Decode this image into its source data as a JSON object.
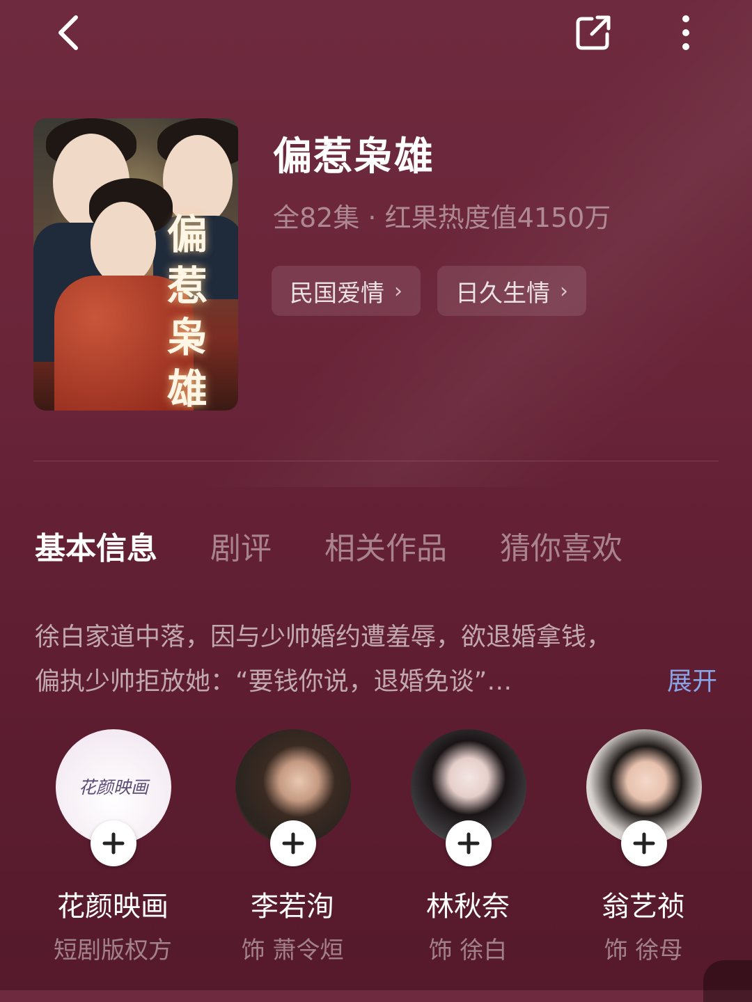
{
  "header": {
    "back_icon": "chevron-left-icon",
    "share_icon": "share-icon",
    "more_icon": "more-vertical-icon"
  },
  "drama": {
    "poster_title": "偏惹枭雄",
    "title": "偏惹枭雄",
    "meta": "全82集 · 红果热度值4150万",
    "tags": [
      {
        "label": "民国爱情",
        "icon": "chevron-right-icon"
      },
      {
        "label": "日久生情",
        "icon": "chevron-right-icon"
      }
    ]
  },
  "tabs": [
    {
      "label": "基本信息",
      "active": true
    },
    {
      "label": "剧评",
      "active": false
    },
    {
      "label": "相关作品",
      "active": false
    },
    {
      "label": "猜你喜欢",
      "active": false
    }
  ],
  "synopsis": {
    "line1": "徐白家道中落，因与少帅婚约遭羞辱，欲退婚拿钱，",
    "line2": "偏执少帅拒放她：“要钱你说，退婚免谈”…",
    "expand_label": "展开"
  },
  "cast": [
    {
      "name": "花颜映画",
      "role": "短剧版权方",
      "avatar_text": "花颜映画"
    },
    {
      "name": "李若洵",
      "role": "饰 萧令烜"
    },
    {
      "name": "林秋奈",
      "role": "饰 徐白"
    },
    {
      "name": "翁艺祯",
      "role": "饰 徐母"
    }
  ],
  "colors": {
    "background": "#6a2539",
    "link": "#8aa4e8"
  }
}
